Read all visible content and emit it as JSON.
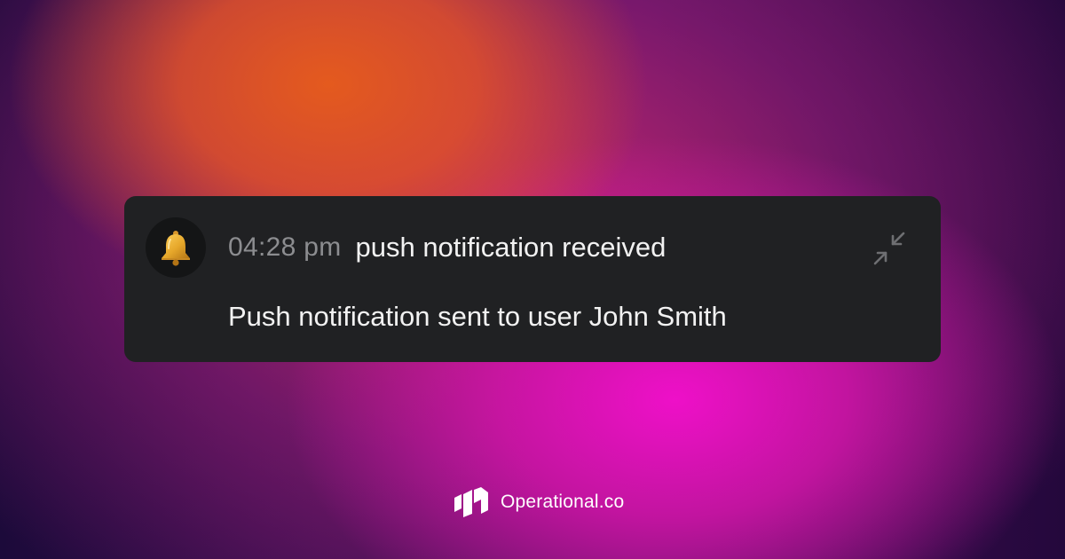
{
  "notification": {
    "icon": "bell-icon",
    "time": "04:28 pm",
    "title": "push notification received",
    "message": "Push notification sent to user John Smith",
    "collapse_icon": "collapse-arrows-icon"
  },
  "brand": {
    "logo_icon": "operational-logo-icon",
    "name": "Operational.co"
  },
  "colors": {
    "card_background": "#202123",
    "avatar_background": "#141516",
    "time_text": "#8c8d90",
    "primary_text": "#f2f2f2",
    "bell": "#e6a72a",
    "collapse_icon": "#6e6f72",
    "gradient_orange": "#e4561e",
    "gradient_magenta": "#ee10c8",
    "gradient_dark": "#1c0a3a"
  }
}
